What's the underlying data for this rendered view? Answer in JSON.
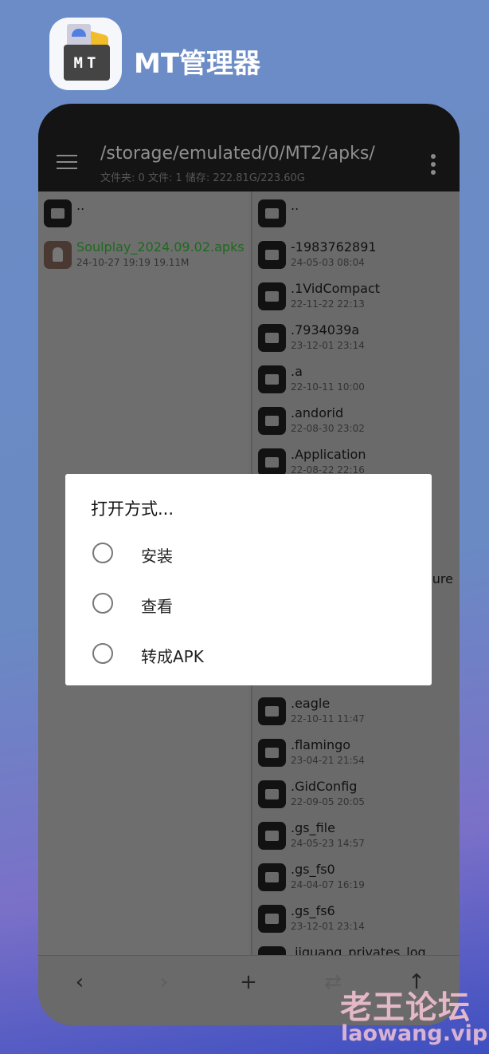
{
  "app": {
    "title": "MT管理器",
    "icon_text": "MT"
  },
  "header": {
    "path": "/storage/emulated/0/MT2/apks/",
    "stats": "文件夹: 0  文件: 1  储存: 222.81G/223.60G"
  },
  "left_pane": {
    "items": [
      {
        "name": "..",
        "date": "",
        "type": "folder"
      },
      {
        "name": "Soulplay_2024.09.02.apks",
        "date": "24-10-27 19:19  19.11M",
        "type": "apk"
      }
    ]
  },
  "right_pane": {
    "items": [
      {
        "name": "..",
        "date": ""
      },
      {
        "name": "-1983762891",
        "date": "24-05-03 08:04"
      },
      {
        "name": ".1VidCompact",
        "date": "22-11-22 22:13"
      },
      {
        "name": ".7934039a",
        "date": "23-12-01 23:14"
      },
      {
        "name": ".a",
        "date": "22-10-11 10:00"
      },
      {
        "name": ".andorid",
        "date": "22-08-30 23:02"
      },
      {
        "name": ".Application",
        "date": "22-08-22 22:16"
      },
      {
        "name": "",
        "date": ""
      },
      {
        "name": "",
        "date": ""
      },
      {
        "name": "ure",
        "date": ""
      },
      {
        "name": "",
        "date": ""
      },
      {
        "name": "",
        "date": ""
      },
      {
        "name": ".eagle",
        "date": "22-10-11 11:47"
      },
      {
        "name": ".flamingo",
        "date": "23-04-21 21:54"
      },
      {
        "name": ".GidConfig",
        "date": "22-09-05 20:05"
      },
      {
        "name": ".gs_file",
        "date": "24-05-23 14:57"
      },
      {
        "name": ".gs_fs0",
        "date": "24-04-07 16:19"
      },
      {
        "name": ".gs_fs6",
        "date": "23-12-01 23:14"
      },
      {
        "name": ".jiguang_privates_log",
        "date": ""
      }
    ]
  },
  "bottom_bar": {
    "icons": [
      "chevron-left",
      "chevron-right",
      "plus",
      "swap",
      "arrow-up"
    ],
    "glyphs": [
      "‹",
      "›",
      "+",
      "⇄",
      "↑"
    ]
  },
  "dialog": {
    "title": "打开方式...",
    "options": [
      {
        "label": "安装",
        "selected": false
      },
      {
        "label": "查看",
        "selected": false
      },
      {
        "label": "转成APK",
        "selected": false
      }
    ]
  },
  "watermark": {
    "line1": "老王论坛",
    "line2": "laowang.vip"
  }
}
